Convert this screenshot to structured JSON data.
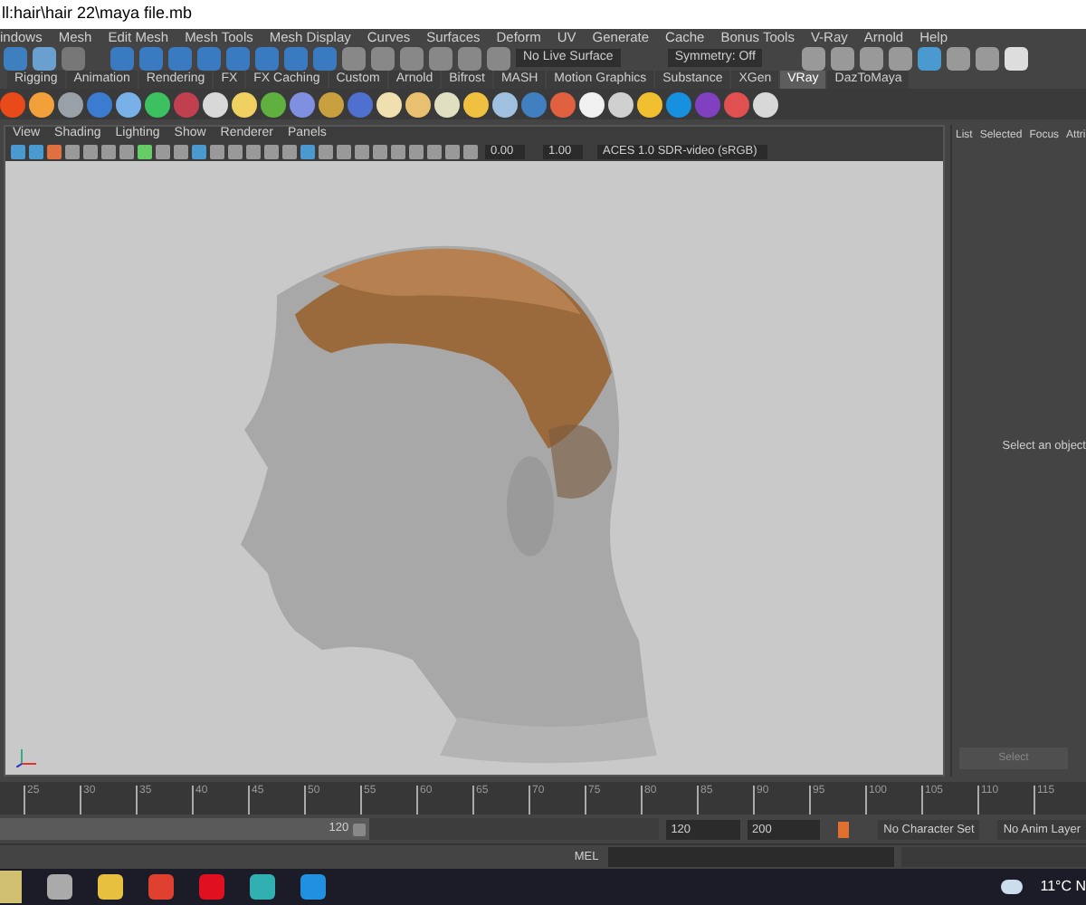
{
  "window": {
    "title": "ll:hair\\hair 22\\maya file.mb"
  },
  "menu_bar": [
    "indows",
    "Mesh",
    "Edit Mesh",
    "Mesh Tools",
    "Mesh Display",
    "Curves",
    "Surfaces",
    "Deform",
    "UV",
    "Generate",
    "Cache",
    "Bonus Tools",
    "V-Ray",
    "Arnold",
    "Help"
  ],
  "status_line": {
    "live_surface": "No Live Surface",
    "symmetry": "Symmetry: Off"
  },
  "shelf_tabs": [
    {
      "label": "Rigging",
      "selected": false
    },
    {
      "label": "Animation",
      "selected": false
    },
    {
      "label": "Rendering",
      "selected": false
    },
    {
      "label": "FX",
      "selected": false
    },
    {
      "label": "FX Caching",
      "selected": false
    },
    {
      "label": "Custom",
      "selected": false
    },
    {
      "label": "Arnold",
      "selected": false
    },
    {
      "label": "Bifrost",
      "selected": false
    },
    {
      "label": "MASH",
      "selected": false
    },
    {
      "label": "Motion Graphics",
      "selected": false
    },
    {
      "label": "Substance",
      "selected": false
    },
    {
      "label": "XGen",
      "selected": false
    },
    {
      "label": "VRay",
      "selected": true
    },
    {
      "label": "DazToMaya",
      "selected": false
    }
  ],
  "viewport": {
    "menu": [
      "View",
      "Shading",
      "Lighting",
      "Show",
      "Renderer",
      "Panels"
    ],
    "gamma": "0.00",
    "exposure": "1.00",
    "color_space": "ACES 1.0 SDR-video (sRGB)"
  },
  "attribute_panel": {
    "tabs": [
      "List",
      "Selected",
      "Focus",
      "Attri"
    ],
    "message": "Select an object",
    "button": "Select"
  },
  "timeline": {
    "ticks": [
      "25",
      "30",
      "35",
      "40",
      "45",
      "50",
      "55",
      "60",
      "65",
      "70",
      "75",
      "80",
      "85",
      "90",
      "95",
      "100",
      "105",
      "110",
      "115"
    ]
  },
  "range": {
    "level": 0.56,
    "slider_end": "120",
    "end": "120",
    "max": "200",
    "character_set": "No Character Set",
    "anim_layer": "No Anim Layer"
  },
  "command_line": {
    "language": "MEL"
  },
  "taskbar": {
    "weather": "11°C N"
  }
}
